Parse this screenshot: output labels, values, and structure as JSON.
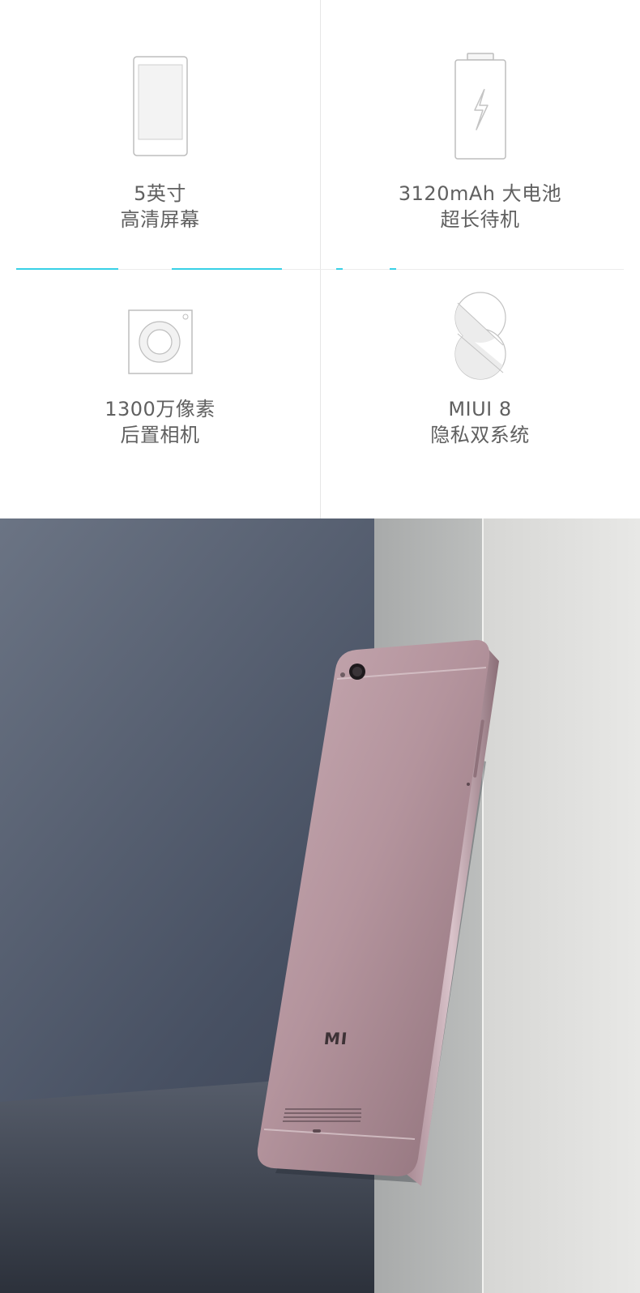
{
  "features": [
    {
      "icon": "phone-screen-icon",
      "line1": "5英寸",
      "line2": "高清屏幕"
    },
    {
      "icon": "battery-icon",
      "line1": "3120mAh 大电池",
      "line2": "超长待机"
    },
    {
      "icon": "camera-icon",
      "line1": "1300万像素",
      "line2": "后置相机"
    },
    {
      "icon": "miui-logo-icon",
      "line1": "MIUI 8",
      "line2": "隐私双系统"
    }
  ],
  "product_photo": {
    "subject": "phone-back",
    "brand_mark": "MI",
    "colors": {
      "background_dark": "#3b4250",
      "phone_body": "#b99aa3",
      "pedestal": "#d8d8d6"
    }
  },
  "colors": {
    "accent": "#38d1e6",
    "text": "#606060",
    "icon_stroke": "#b5b5b5"
  }
}
